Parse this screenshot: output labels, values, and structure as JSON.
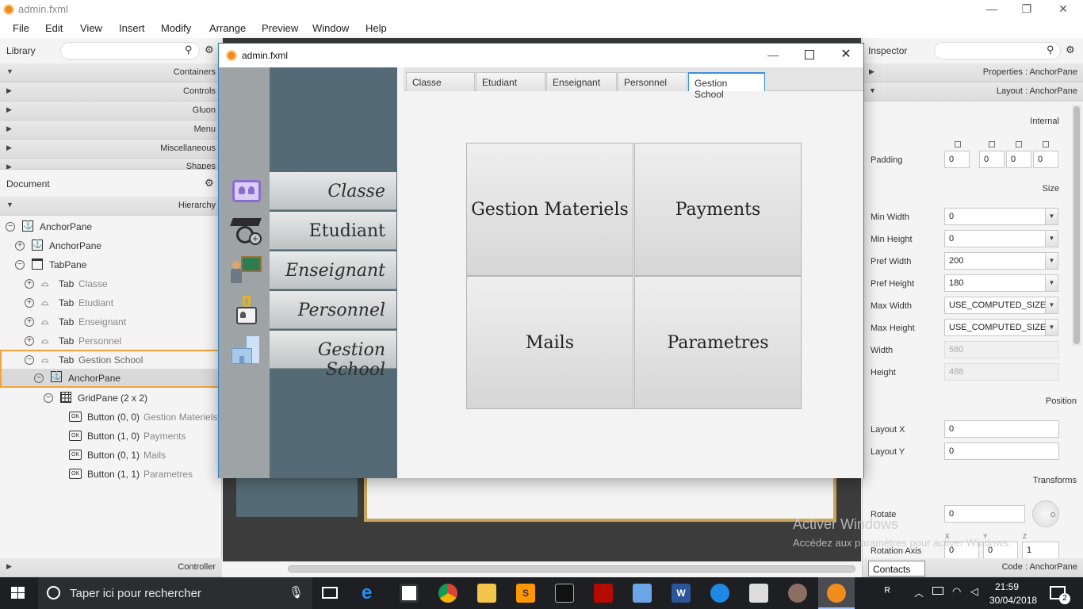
{
  "window": {
    "title": "admin.fxml"
  },
  "menu": [
    "File",
    "Edit",
    "View",
    "Insert",
    "Modify",
    "Arrange",
    "Preview",
    "Window",
    "Help"
  ],
  "library": {
    "title": "Library",
    "sections": [
      "Containers",
      "Controls",
      "Gluon",
      "Menu",
      "Miscellaneous",
      "Shapes"
    ]
  },
  "document": {
    "title": "Document",
    "hierarchy_label": "Hierarchy",
    "tree": [
      {
        "icon": "anchor",
        "label": "AnchorPane",
        "extra": ""
      },
      {
        "icon": "anchor",
        "label": "AnchorPane",
        "extra": ""
      },
      {
        "icon": "tabpane",
        "label": "TabPane",
        "extra": ""
      },
      {
        "icon": "tab",
        "label": "Tab",
        "extra": "Classe"
      },
      {
        "icon": "tab",
        "label": "Tab",
        "extra": "Etudiant"
      },
      {
        "icon": "tab",
        "label": "Tab",
        "extra": "Enseignant"
      },
      {
        "icon": "tab",
        "label": "Tab",
        "extra": "Personnel"
      },
      {
        "icon": "tab",
        "label": "Tab",
        "extra": "Gestion School"
      },
      {
        "icon": "anchor",
        "label": "AnchorPane",
        "extra": ""
      },
      {
        "icon": "grid",
        "label": "GridPane (2 x 2)",
        "extra": ""
      },
      {
        "icon": "button",
        "label": "Button (0, 0)",
        "extra": "Gestion Materiels"
      },
      {
        "icon": "button",
        "label": "Button (1, 0)",
        "extra": "Payments"
      },
      {
        "icon": "button",
        "label": "Button (0, 1)",
        "extra": "Mails"
      },
      {
        "icon": "button",
        "label": "Button (1, 1)",
        "extra": "Parametres"
      }
    ],
    "controller_label": "Controller"
  },
  "inspector": {
    "title": "Inspector",
    "properties": "Properties : AnchorPane",
    "layout": "Layout : AnchorPane",
    "internal": "Internal",
    "padding_label": "Padding",
    "padding": [
      "0",
      "0",
      "0",
      "0"
    ],
    "size": "Size",
    "min_width_label": "Min Width",
    "min_width": "0",
    "min_height_label": "Min Height",
    "min_height": "0",
    "pref_width_label": "Pref Width",
    "pref_width": "200",
    "pref_height_label": "Pref Height",
    "pref_height": "180",
    "max_width_label": "Max Width",
    "max_width": "USE_COMPUTED_SIZE",
    "max_height_label": "Max Height",
    "max_height": "USE_COMPUTED_SIZE",
    "width_label": "Width",
    "width": "580",
    "height_label": "Height",
    "height": "488",
    "position": "Position",
    "layout_x_label": "Layout X",
    "layout_x": "0",
    "layout_y_label": "Layout Y",
    "layout_y": "0",
    "transforms": "Transforms",
    "rotate_label": "Rotate",
    "rotate": "0",
    "rotation_axis_label": "Rotation Axis",
    "rotation_axis": [
      "0",
      "0",
      "1"
    ],
    "axis_letters": [
      "X",
      "Y",
      "Z"
    ],
    "code": "Code : AnchorPane",
    "contacts": "Contacts"
  },
  "dialog": {
    "title": "admin.fxml",
    "nav": [
      "Classe",
      "Etudiant",
      "Enseignant",
      "Personnel",
      "Gestion School"
    ],
    "tabs": [
      "Classe",
      "Etudiant",
      "Enseignant",
      "Personnel",
      "Gestion School"
    ],
    "selected_tab": "Gestion School",
    "buttons": [
      "Gestion Materiels",
      "Payments",
      "Mails",
      "Parametres"
    ]
  },
  "watermark": {
    "line1": "Activer Windows",
    "line2": "Accédez aux paramètres pour activer Windows."
  },
  "taskbar": {
    "search_placeholder": "Taper ici pour rechercher",
    "time": "21:59",
    "date": "30/04/2018",
    "notifications": "2"
  }
}
